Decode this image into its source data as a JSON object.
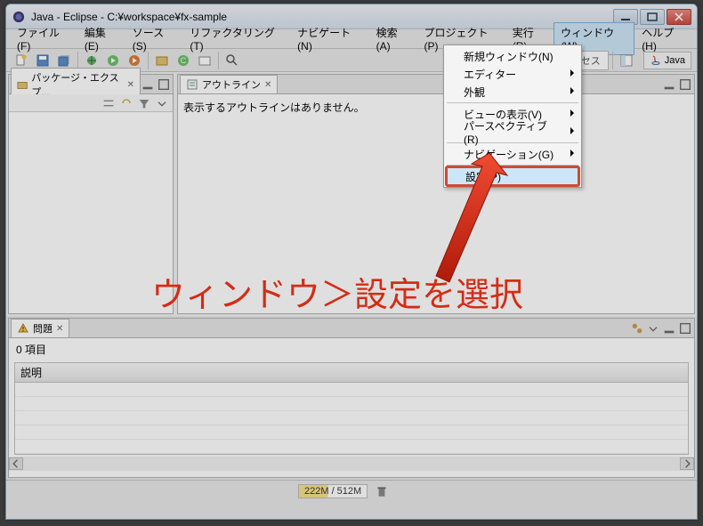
{
  "window": {
    "title": "Java - Eclipse - C:¥workspace¥fx-sample"
  },
  "menubar": {
    "items": [
      "ファイル(F)",
      "編集(E)",
      "ソース(S)",
      "リファクタリング(T)",
      "ナビゲート(N)",
      "検索(A)",
      "プロジェクト(P)",
      "実行(R)",
      "ウィンドウ(W)",
      "ヘルプ(H)"
    ],
    "open_index": 8
  },
  "dropdown": {
    "items": [
      {
        "label": "新規ウィンドウ(N)",
        "submenu": false
      },
      {
        "label": "エディター",
        "submenu": true
      },
      {
        "label": "外観",
        "submenu": true
      },
      {
        "sep": true
      },
      {
        "label": "ビューの表示(V)",
        "submenu": true
      },
      {
        "label": "パースペクティブ(R)",
        "submenu": true
      },
      {
        "sep": true
      },
      {
        "label": "ナビゲーション(G)",
        "submenu": true
      },
      {
        "sep": true
      },
      {
        "label": "設定(P)",
        "submenu": false,
        "highlight": true
      }
    ]
  },
  "toolbar": {
    "quick_access": "アクセス",
    "perspective_label": "Java"
  },
  "views": {
    "package_explorer": {
      "tab": "パッケージ・エクスプ..."
    },
    "outline": {
      "tab": "アウトライン",
      "empty_text": "表示するアウトラインはありません。"
    },
    "problems": {
      "tab": "問題",
      "summary": "0 項目",
      "header": "説明"
    }
  },
  "status": {
    "heap": "222M / 512M"
  },
  "annotation": {
    "text": "ウィンドウ＞設定を選択"
  }
}
